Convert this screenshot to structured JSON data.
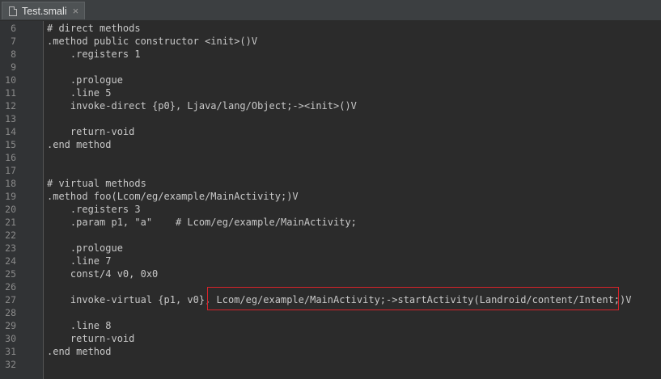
{
  "tab": {
    "title": "Test.smali",
    "close": "×"
  },
  "lines": [
    {
      "num": "6",
      "text": "# direct methods"
    },
    {
      "num": "7",
      "text": ".method public constructor <init>()V"
    },
    {
      "num": "8",
      "text": "    .registers 1"
    },
    {
      "num": "9",
      "text": ""
    },
    {
      "num": "10",
      "text": "    .prologue"
    },
    {
      "num": "11",
      "text": "    .line 5"
    },
    {
      "num": "12",
      "text": "    invoke-direct {p0}, Ljava/lang/Object;-><init>()V"
    },
    {
      "num": "13",
      "text": ""
    },
    {
      "num": "14",
      "text": "    return-void"
    },
    {
      "num": "15",
      "text": ".end method"
    },
    {
      "num": "16",
      "text": ""
    },
    {
      "num": "17",
      "text": ""
    },
    {
      "num": "18",
      "text": "# virtual methods"
    },
    {
      "num": "19",
      "text": ".method foo(Lcom/eg/example/MainActivity;)V"
    },
    {
      "num": "20",
      "text": "    .registers 3"
    },
    {
      "num": "21",
      "text": "    .param p1, \"a\"    # Lcom/eg/example/MainActivity;"
    },
    {
      "num": "22",
      "text": ""
    },
    {
      "num": "23",
      "text": "    .prologue"
    },
    {
      "num": "24",
      "text": "    .line 7"
    },
    {
      "num": "25",
      "text": "    const/4 v0, 0x0"
    },
    {
      "num": "26",
      "text": ""
    },
    {
      "num": "27",
      "text": "    invoke-virtual {p1, v0}, Lcom/eg/example/MainActivity;->startActivity(Landroid/content/Intent;)V"
    },
    {
      "num": "28",
      "text": ""
    },
    {
      "num": "29",
      "text": "    .line 8"
    },
    {
      "num": "30",
      "text": "    return-void"
    },
    {
      "num": "31",
      "text": ".end method"
    },
    {
      "num": "32",
      "text": ""
    }
  ],
  "colors": {
    "background": "#2b2b2b",
    "gutter": "#313335",
    "highlight_border": "#d8232a"
  }
}
